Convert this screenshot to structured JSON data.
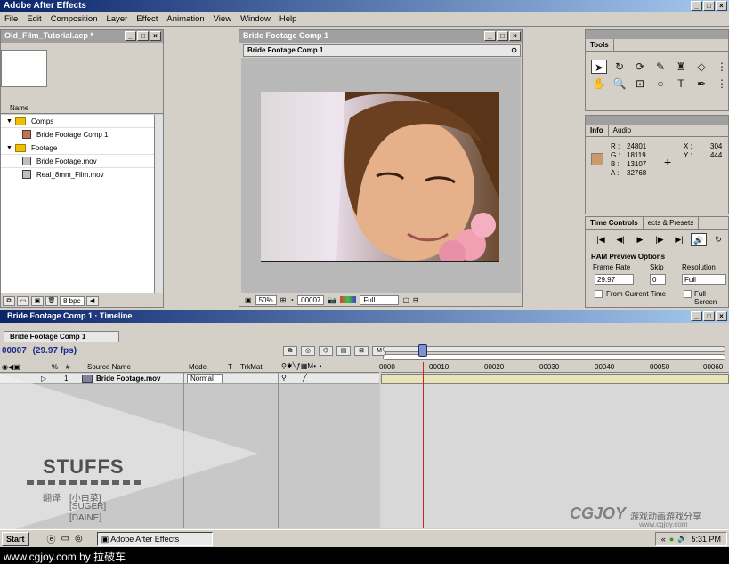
{
  "app": {
    "title": "Adobe After Effects"
  },
  "window_controls": [
    "_",
    "□",
    "×"
  ],
  "menu": [
    "File",
    "Edit",
    "Composition",
    "Layer",
    "Effect",
    "Animation",
    "View",
    "Window",
    "Help"
  ],
  "project": {
    "title": "Old_Film_Tutorial.aep *",
    "column_name": "Name",
    "items": [
      {
        "label": "Comps",
        "type": "folder"
      },
      {
        "label": "Bride Footage Comp 1",
        "type": "comp"
      },
      {
        "label": "Footage",
        "type": "folder"
      },
      {
        "label": "Bride Footage.mov",
        "type": "footage"
      },
      {
        "label": "Real_8mm_Film.mov",
        "type": "footage"
      }
    ],
    "bpc": "8 bpc"
  },
  "comp": {
    "window_title": "Bride Footage Comp 1",
    "tab": "Bride Footage Comp 1",
    "zoom": "50%",
    "timecode": "00007",
    "resolution": "Full"
  },
  "tools": {
    "title": "Tools"
  },
  "info": {
    "tabs": [
      "Info",
      "Audio"
    ],
    "r_label": "R :",
    "r": "24801",
    "g_label": "G :",
    "g": "18119",
    "b_label": "B :",
    "b": "13107",
    "a_label": "A :",
    "a": "32768",
    "x_label": "X :",
    "x": "304",
    "y_label": "Y :",
    "y": "444",
    "swatch": "#c89a6e"
  },
  "time_controls": {
    "tabs": [
      "Time Controls",
      "ects & Presets"
    ],
    "ram_preview": "RAM Preview Options",
    "frame_rate_label": "Frame Rate",
    "frame_rate": "29.97",
    "skip_label": "Skip",
    "skip": "0",
    "resolution_label": "Resolution",
    "resolution": "Full",
    "from_current": "From Current Time",
    "full_screen": "Full Screen"
  },
  "timeline": {
    "title": "Bride Footage Comp 1 · Timeline",
    "tab": "Bride Footage Comp 1",
    "timecode": "00007",
    "fps": "(29.97 fps)",
    "col_source": "Source Name",
    "col_mode": "Mode",
    "col_t": "T",
    "col_trkmat": "TrkMat",
    "layer_index": "1",
    "layer_name": "Bride Footage.mov",
    "layer_mode": "Normal",
    "ruler": [
      "0000",
      "00010",
      "00020",
      "00030",
      "00040",
      "00050",
      "00060"
    ]
  },
  "watermark": {
    "brand": "STUFFS",
    "credit_label": "翻译",
    "credit_1": "[小白菜]",
    "credit_2": "[SUGER]",
    "credit_3": "[DAINE]",
    "cgjoy_logo": "CGJOY",
    "cgjoy_cn": "游戏动画游戏分享",
    "cgjoy_url": "www.cgjoy.com"
  },
  "taskbar": {
    "start": "Start",
    "task": "Adobe After Effects",
    "clock": "5:31 PM"
  },
  "caption": "www.cgjoy.com by 拉破车"
}
